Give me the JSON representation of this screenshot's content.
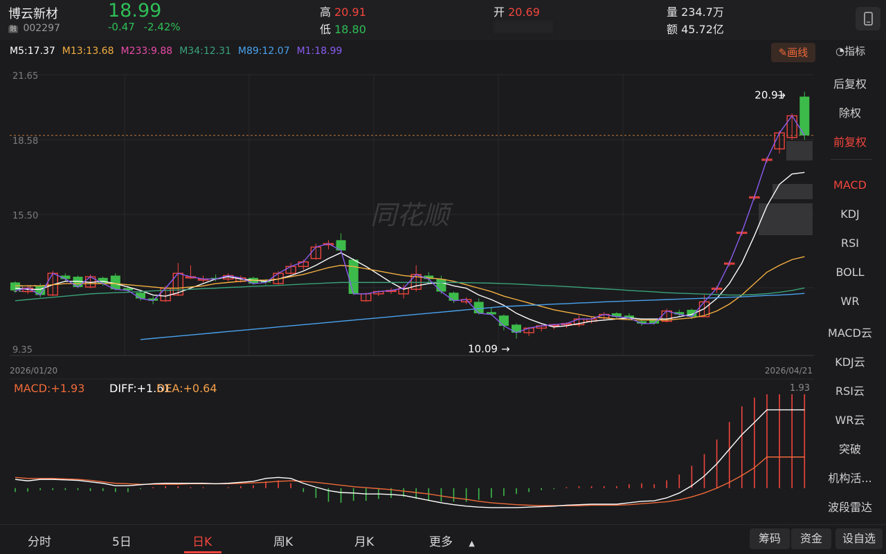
{
  "stock": {
    "name": "博云新材",
    "tag": "融",
    "code": "002297",
    "price": "18.99",
    "change": "-0.47",
    "change_pct": "-2.42%",
    "high_label": "高",
    "high": "20.91",
    "low_label": "低",
    "low": "18.80",
    "open_label": "开",
    "open": "20.69",
    "volume_label": "量",
    "volume": "234.7万",
    "amount_label": "额",
    "amount": "45.72亿"
  },
  "ma_legend": [
    {
      "label": "M5:17.37",
      "color": "#ffffff"
    },
    {
      "label": "M13:13.68",
      "color": "#f5b041"
    },
    {
      "label": "M233:9.88",
      "color": "#e84ba8"
    },
    {
      "label": "M34:12.31",
      "color": "#3aa37a"
    },
    {
      "label": "M89:12.07",
      "color": "#4aa3f0"
    },
    {
      "label": "M1:18.99",
      "color": "#8a5cf0"
    }
  ],
  "toolbar": {
    "draw_label": "画线",
    "indicator_label": "指标"
  },
  "chart_data": {
    "type": "candlestick",
    "ylim": [
      9.35,
      21.65
    ],
    "y_ticks": [
      "21.65",
      "18.58",
      "15.50",
      "12.42",
      "9.35"
    ],
    "x_start": "2026/01/20",
    "x_end": "2026/04/21",
    "watermark": "同花顺",
    "max_marker": "20.91",
    "min_marker": "10.09",
    "candles": [
      [
        12.55,
        12.2,
        12.6,
        12.1
      ],
      [
        12.15,
        12.3,
        12.45,
        12.05
      ],
      [
        12.4,
        12.0,
        12.5,
        11.9
      ],
      [
        12.0,
        12.95,
        13.05,
        11.95
      ],
      [
        12.85,
        12.7,
        12.95,
        12.6
      ],
      [
        12.8,
        12.35,
        12.85,
        12.3
      ],
      [
        12.35,
        12.8,
        12.9,
        12.3
      ],
      [
        12.75,
        12.5,
        12.8,
        12.4
      ],
      [
        12.85,
        12.25,
        12.95,
        12.2
      ],
      [
        12.3,
        12.2,
        12.4,
        12.1
      ],
      [
        12.1,
        11.85,
        12.2,
        11.75
      ],
      [
        11.85,
        11.75,
        11.95,
        11.6
      ],
      [
        11.75,
        12.3,
        12.4,
        11.7
      ],
      [
        12.0,
        12.95,
        13.4,
        11.95
      ],
      [
        12.75,
        12.8,
        13.3,
        12.7
      ],
      [
        12.65,
        12.7,
        12.85,
        12.55
      ],
      [
        12.75,
        12.7,
        12.9,
        12.6
      ],
      [
        12.7,
        12.85,
        12.95,
        12.6
      ],
      [
        12.6,
        12.75,
        12.85,
        12.55
      ],
      [
        12.75,
        12.5,
        12.8,
        12.45
      ],
      [
        12.6,
        12.55,
        12.7,
        12.45
      ],
      [
        12.5,
        12.95,
        13.05,
        12.45
      ],
      [
        12.95,
        13.25,
        13.4,
        12.9
      ],
      [
        13.25,
        13.45,
        13.55,
        13.1
      ],
      [
        13.6,
        14.1,
        14.25,
        13.55
      ],
      [
        14.2,
        14.25,
        14.4,
        14.0
      ],
      [
        14.4,
        13.95,
        14.7,
        13.95
      ],
      [
        13.55,
        12.05,
        13.6,
        12.0
      ],
      [
        11.75,
        12.05,
        12.1,
        11.7
      ],
      [
        12.05,
        12.15,
        12.2,
        11.95
      ],
      [
        12.2,
        12.2,
        12.3,
        12.05
      ],
      [
        12.05,
        12.3,
        12.45,
        11.85
      ],
      [
        12.25,
        12.9,
        13.3,
        12.15
      ],
      [
        12.85,
        12.7,
        13.0,
        12.55
      ],
      [
        12.7,
        12.15,
        12.85,
        12.05
      ],
      [
        12.1,
        11.75,
        12.15,
        11.65
      ],
      [
        11.7,
        11.8,
        11.9,
        11.6
      ],
      [
        11.7,
        11.2,
        11.85,
        11.15
      ],
      [
        11.25,
        11.15,
        11.45,
        11.1
      ],
      [
        11.1,
        10.65,
        11.15,
        10.45
      ],
      [
        10.7,
        10.35,
        10.75,
        10.09
      ],
      [
        10.35,
        10.55,
        10.6,
        10.2
      ],
      [
        10.55,
        10.65,
        10.7,
        10.4
      ],
      [
        10.7,
        10.7,
        10.75,
        10.5
      ],
      [
        10.7,
        10.75,
        10.8,
        10.55
      ],
      [
        10.7,
        10.95,
        11.1,
        10.6
      ],
      [
        10.85,
        10.95,
        11.05,
        10.75
      ],
      [
        11.0,
        11.15,
        11.25,
        10.9
      ],
      [
        11.2,
        11.05,
        11.25,
        10.95
      ],
      [
        11.1,
        11.0,
        11.2,
        10.9
      ],
      [
        10.85,
        10.75,
        10.95,
        10.65
      ],
      [
        10.9,
        10.75,
        10.95,
        10.7
      ],
      [
        10.85,
        11.3,
        11.4,
        10.8
      ],
      [
        11.25,
        11.15,
        11.35,
        11.05
      ],
      [
        11.35,
        11.05,
        11.4,
        10.95
      ],
      [
        11.05,
        11.7,
        12.0,
        11.05
      ],
      [
        12.25,
        12.3,
        12.4,
        12.1
      ],
      [
        13.35,
        13.4,
        13.5,
        13.25
      ],
      [
        14.7,
        14.75,
        14.85,
        14.6
      ],
      [
        16.25,
        16.3,
        16.4,
        16.15
      ],
      [
        17.9,
        17.95,
        18.05,
        17.8
      ],
      [
        18.4,
        19.1,
        19.2,
        18.2
      ],
      [
        18.9,
        19.85,
        19.95,
        18.8
      ],
      [
        20.69,
        18.99,
        20.91,
        18.8
      ]
    ],
    "ma_series": [
      {
        "name": "M5",
        "color": "#ffffff",
        "values": [
          12.3,
          12.25,
          12.25,
          12.45,
          12.6,
          12.6,
          12.55,
          12.6,
          12.5,
          12.35,
          12.2,
          12.0,
          11.95,
          12.1,
          12.3,
          12.5,
          12.7,
          12.8,
          12.7,
          12.65,
          12.6,
          12.7,
          12.85,
          13.05,
          13.3,
          13.6,
          13.85,
          13.55,
          13.25,
          12.9,
          12.55,
          12.25,
          12.4,
          12.5,
          12.55,
          12.4,
          12.3,
          12.0,
          11.8,
          11.55,
          11.2,
          10.95,
          10.75,
          10.6,
          10.65,
          10.75,
          10.85,
          10.9,
          10.95,
          11.0,
          10.95,
          10.95,
          10.95,
          11.05,
          11.15,
          11.4,
          11.85,
          12.5,
          13.4,
          14.6,
          15.9,
          16.85,
          17.3,
          17.37
        ]
      },
      {
        "name": "M13",
        "color": "#f5b041",
        "values": [
          12.4,
          12.4,
          12.4,
          12.45,
          12.5,
          12.5,
          12.5,
          12.5,
          12.5,
          12.45,
          12.4,
          12.35,
          12.3,
          12.3,
          12.35,
          12.4,
          12.5,
          12.55,
          12.6,
          12.65,
          12.65,
          12.7,
          12.8,
          12.9,
          13.05,
          13.2,
          13.3,
          13.25,
          13.15,
          13.05,
          12.95,
          12.85,
          12.8,
          12.75,
          12.7,
          12.6,
          12.45,
          12.3,
          12.15,
          11.95,
          11.8,
          11.65,
          11.5,
          11.35,
          11.25,
          11.15,
          11.05,
          11.0,
          10.95,
          10.92,
          10.9,
          10.9,
          10.9,
          10.95,
          11.0,
          11.1,
          11.3,
          11.6,
          12.0,
          12.5,
          13.0,
          13.3,
          13.55,
          13.68
        ]
      },
      {
        "name": "M34",
        "color": "#3aa37a",
        "values": [
          11.75,
          11.8,
          11.85,
          11.9,
          11.95,
          12.0,
          12.05,
          12.08,
          12.1,
          12.12,
          12.15,
          12.18,
          12.2,
          12.22,
          12.25,
          12.28,
          12.3,
          12.33,
          12.35,
          12.38,
          12.4,
          12.42,
          12.45,
          12.48,
          12.5,
          12.53,
          12.55,
          12.55,
          12.55,
          12.55,
          12.55,
          12.55,
          12.55,
          12.55,
          12.55,
          12.55,
          12.54,
          12.53,
          12.52,
          12.5,
          12.48,
          12.45,
          12.42,
          12.4,
          12.37,
          12.34,
          12.3,
          12.27,
          12.24,
          12.2,
          12.17,
          12.14,
          12.1,
          12.08,
          12.06,
          12.04,
          12.02,
          12.0,
          12.0,
          12.02,
          12.06,
          12.12,
          12.2,
          12.31
        ]
      },
      {
        "name": "M89",
        "color": "#4aa3f0",
        "values": [
          null,
          null,
          null,
          null,
          null,
          null,
          null,
          null,
          null,
          null,
          10.05,
          10.1,
          10.15,
          10.2,
          10.25,
          10.3,
          10.35,
          10.4,
          10.45,
          10.5,
          10.55,
          10.6,
          10.65,
          10.7,
          10.75,
          10.8,
          10.85,
          10.9,
          10.95,
          11.0,
          11.05,
          11.1,
          11.15,
          11.2,
          11.25,
          11.3,
          11.35,
          11.4,
          11.45,
          11.5,
          11.52,
          11.55,
          11.57,
          11.6,
          11.62,
          11.65,
          11.67,
          11.7,
          11.72,
          11.74,
          11.76,
          11.78,
          11.8,
          11.82,
          11.84,
          11.86,
          11.88,
          11.9,
          11.92,
          11.95,
          11.98,
          12.0,
          12.03,
          12.07
        ]
      },
      {
        "name": "M1",
        "color": "#8a5cf0",
        "values": [
          12.2,
          12.3,
          12.0,
          12.95,
          12.7,
          12.35,
          12.8,
          12.5,
          12.25,
          12.2,
          11.85,
          11.75,
          12.3,
          12.95,
          12.8,
          12.7,
          12.7,
          12.85,
          12.75,
          12.5,
          12.55,
          12.95,
          13.25,
          13.45,
          14.1,
          14.25,
          13.95,
          12.05,
          12.05,
          12.15,
          12.2,
          12.3,
          12.9,
          12.7,
          12.15,
          11.75,
          11.8,
          11.2,
          11.15,
          10.65,
          10.35,
          10.55,
          10.65,
          10.7,
          10.75,
          10.95,
          10.95,
          11.15,
          11.05,
          11.0,
          10.75,
          10.75,
          11.3,
          11.15,
          11.05,
          11.7,
          12.3,
          13.4,
          14.75,
          16.3,
          17.95,
          19.1,
          19.85,
          18.99
        ]
      }
    ],
    "macd_legend": {
      "macd": "MACD:+1.93",
      "diff": "DIFF:+1.61",
      "dea": "DEA:+0.64",
      "max": "1.93"
    },
    "macd": {
      "ylim": [
        -0.6,
        1.93
      ],
      "diff": [
        0.18,
        0.15,
        0.18,
        0.18,
        0.17,
        0.16,
        0.13,
        0.1,
        0.05,
        0.05,
        0.07,
        0.09,
        0.1,
        0.1,
        0.1,
        0.1,
        0.09,
        0.1,
        0.12,
        0.14,
        0.2,
        0.22,
        0.2,
        0.1,
        0.02,
        -0.05,
        -0.09,
        -0.1,
        -0.12,
        -0.12,
        -0.13,
        -0.15,
        -0.2,
        -0.25,
        -0.3,
        -0.34,
        -0.37,
        -0.39,
        -0.4,
        -0.4,
        -0.4,
        -0.39,
        -0.38,
        -0.37,
        -0.35,
        -0.34,
        -0.33,
        -0.33,
        -0.33,
        -0.3,
        -0.27,
        -0.26,
        -0.2,
        -0.1,
        0.05,
        0.25,
        0.5,
        0.8,
        1.1,
        1.35,
        1.61,
        1.61,
        1.61,
        1.61
      ],
      "dea": [
        0.22,
        0.2,
        0.2,
        0.2,
        0.19,
        0.18,
        0.16,
        0.13,
        0.1,
        0.09,
        0.08,
        0.08,
        0.08,
        0.08,
        0.09,
        0.09,
        0.09,
        0.09,
        0.1,
        0.11,
        0.12,
        0.14,
        0.15,
        0.14,
        0.12,
        0.09,
        0.06,
        0.03,
        0.01,
        -0.01,
        -0.03,
        -0.06,
        -0.09,
        -0.12,
        -0.16,
        -0.2,
        -0.23,
        -0.27,
        -0.3,
        -0.32,
        -0.34,
        -0.35,
        -0.36,
        -0.36,
        -0.36,
        -0.36,
        -0.35,
        -0.35,
        -0.35,
        -0.34,
        -0.32,
        -0.3,
        -0.28,
        -0.24,
        -0.18,
        -0.1,
        0.0,
        0.12,
        0.26,
        0.42,
        0.64,
        0.64,
        0.64,
        0.64
      ],
      "hist": [
        -0.08,
        -0.07,
        -0.04,
        -0.04,
        -0.04,
        -0.04,
        -0.06,
        -0.06,
        -0.08,
        -0.08,
        -0.02,
        0.02,
        0.04,
        0.04,
        0.02,
        0.02,
        0.0,
        0.02,
        0.04,
        0.06,
        0.14,
        0.16,
        0.1,
        -0.08,
        -0.2,
        -0.28,
        -0.3,
        -0.26,
        -0.26,
        -0.22,
        -0.2,
        -0.18,
        -0.22,
        -0.26,
        -0.28,
        -0.28,
        -0.28,
        -0.24,
        -0.2,
        -0.16,
        -0.12,
        -0.08,
        -0.04,
        -0.02,
        0.02,
        0.04,
        0.04,
        0.04,
        0.04,
        0.08,
        0.1,
        0.08,
        0.16,
        0.28,
        0.46,
        0.7,
        1.0,
        1.36,
        1.68,
        1.86,
        1.93,
        1.93,
        1.93,
        1.93
      ]
    }
  },
  "sidebar": {
    "items": [
      "后复权",
      "除权",
      "前复权",
      "MACD",
      "KDJ",
      "RSI",
      "BOLL",
      "WR",
      "MACD云",
      "KDJ云",
      "RSI云",
      "WR云",
      "突破",
      "机构活...",
      "波段雷达"
    ]
  },
  "bottom_tabs": [
    "分时",
    "5日",
    "日K",
    "周K",
    "月K",
    "更多"
  ],
  "bottom_buttons": [
    "筹码",
    "资金",
    "设自选"
  ]
}
